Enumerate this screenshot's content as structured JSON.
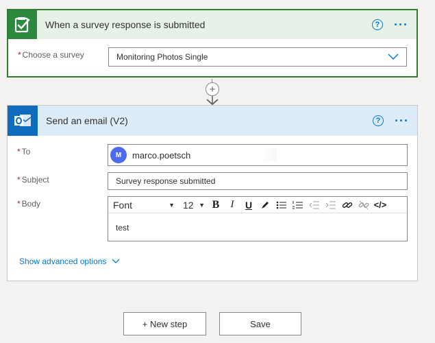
{
  "trigger": {
    "title": "When a survey response is submitted",
    "help_glyph": "?",
    "more_glyph": "···",
    "survey_label": "Choose a survey",
    "survey_value": "Monitoring Photos Single",
    "icon": "forms-checklist-icon",
    "color": "#2b8a3e"
  },
  "action": {
    "title": "Send an email (V2)",
    "help_glyph": "?",
    "more_glyph": "···",
    "icon": "outlook-icon",
    "color": "#0f6cbd",
    "to_label": "To",
    "to_avatar": "M",
    "to_value": "marco.poetsch",
    "subject_label": "Subject",
    "subject_value": "Survey response submitted",
    "body_label": "Body",
    "font_value": "Font",
    "size_value": "12",
    "body_text": "test",
    "advanced_link": "Show advanced options"
  },
  "required_marker": "*",
  "connector": {
    "plus_glyph": "+"
  },
  "buttons": {
    "new_step": "+ New step",
    "save": "Save"
  }
}
